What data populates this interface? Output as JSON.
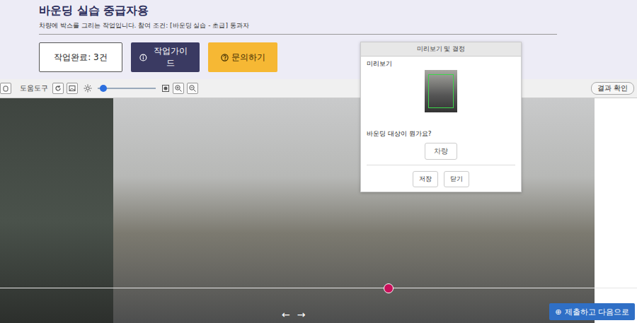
{
  "header": {
    "title": "바운딩 실습 중급자용",
    "subtitle": "차량에 박스를 그리는 작업입니다. 참여 조건: [바운딩 실습 - 초급] 통과자",
    "completed": "작업완료: 3건",
    "guide_button": "작업가이드",
    "inquiry_button": "문의하기"
  },
  "toolbar": {
    "label": "도움도구",
    "brightness": {
      "level": 0.1
    },
    "result_button": "결과 확인"
  },
  "dialog": {
    "title": "미리보기 및 결정",
    "preview_label": "미리보기",
    "question": "바운딩 대상이 뭔가요?",
    "options": [
      {
        "label": "차량",
        "selected": false
      }
    ],
    "buttons": [
      "저장",
      "닫기"
    ]
  },
  "video": {
    "progress": {
      "level": 0.61
    },
    "prev": "←",
    "next": "→"
  },
  "submit_button": {
    "icon": "⊕",
    "label": "제출하고 다음으로"
  }
}
